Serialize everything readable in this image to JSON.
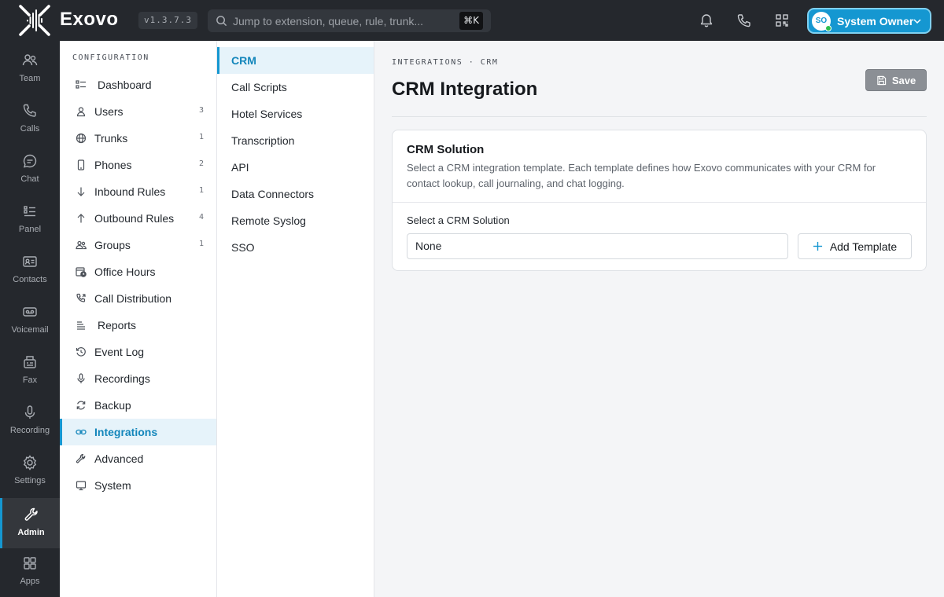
{
  "colors": {
    "accent": "#1597d1",
    "topbar": "#25282d",
    "active_bg": "#e6f3fa",
    "online": "#2fbf4b"
  },
  "topbar": {
    "brand": "Exovo",
    "version": "v1.3.7.3",
    "search_placeholder": "Jump to extension, queue, rule, trunk...",
    "shortcut": "⌘K",
    "icons": [
      "bell-icon",
      "phone-icon",
      "qr-code-icon"
    ],
    "user": {
      "initials": "SO",
      "name": "System Owner",
      "status": "online"
    }
  },
  "rail": {
    "items": [
      {
        "label": "Team",
        "icon": "team-icon"
      },
      {
        "label": "Calls",
        "icon": "phone-icon"
      },
      {
        "label": "Chat",
        "icon": "chat-icon"
      },
      {
        "label": "Panel",
        "icon": "panel-icon"
      },
      {
        "label": "Contacts",
        "icon": "contacts-icon"
      },
      {
        "label": "Voicemail",
        "icon": "voicemail-icon"
      },
      {
        "label": "Fax",
        "icon": "fax-icon"
      },
      {
        "label": "Recording",
        "icon": "microphone-icon"
      },
      {
        "label": "Settings",
        "icon": "gear-icon"
      },
      {
        "label": "Admin",
        "icon": "wrench-icon",
        "active": true
      },
      {
        "label": "Apps",
        "icon": "apps-icon"
      }
    ]
  },
  "config": {
    "title": "CONFIGURATION",
    "items": [
      {
        "label": "Dashboard",
        "icon": "dashboard-icon",
        "count": ""
      },
      {
        "label": "Users",
        "icon": "user-icon",
        "count": "3"
      },
      {
        "label": "Trunks",
        "icon": "globe-icon",
        "count": "1"
      },
      {
        "label": "Phones",
        "icon": "phone-device-icon",
        "count": "2"
      },
      {
        "label": "Inbound Rules",
        "icon": "arrow-down-icon",
        "count": "1"
      },
      {
        "label": "Outbound Rules",
        "icon": "arrow-up-icon",
        "count": "4"
      },
      {
        "label": "Groups",
        "icon": "groups-icon",
        "count": "1"
      },
      {
        "label": "Office Hours",
        "icon": "calendar-clock-icon",
        "count": ""
      },
      {
        "label": "Call Distribution",
        "icon": "call-forward-icon",
        "count": ""
      },
      {
        "label": "Reports",
        "icon": "reports-icon",
        "count": ""
      },
      {
        "label": "Event Log",
        "icon": "history-icon",
        "count": ""
      },
      {
        "label": "Recordings",
        "icon": "microphone-icon",
        "count": ""
      },
      {
        "label": "Backup",
        "icon": "refresh-icon",
        "count": ""
      },
      {
        "label": "Integrations",
        "icon": "link-icon",
        "count": "",
        "active": true
      },
      {
        "label": "Advanced",
        "icon": "wrench-icon",
        "count": ""
      },
      {
        "label": "System",
        "icon": "monitor-icon",
        "count": ""
      }
    ]
  },
  "subnav": {
    "items": [
      {
        "label": "CRM",
        "active": true
      },
      {
        "label": "Call Scripts"
      },
      {
        "label": "Hotel Services"
      },
      {
        "label": "Transcription"
      },
      {
        "label": "API"
      },
      {
        "label": "Data Connectors"
      },
      {
        "label": "Remote Syslog"
      },
      {
        "label": "SSO"
      }
    ]
  },
  "main": {
    "breadcrumb": "INTEGRATIONS · CRM",
    "title": "CRM Integration",
    "save_label": "Save",
    "card": {
      "title": "CRM Solution",
      "description": "Select a CRM integration template. Each template defines how Exovo communicates with your CRM for contact lookup, call journaling, and chat logging.",
      "field_label": "Select a CRM Solution",
      "selected_value": "None",
      "add_label": "Add Template"
    }
  }
}
